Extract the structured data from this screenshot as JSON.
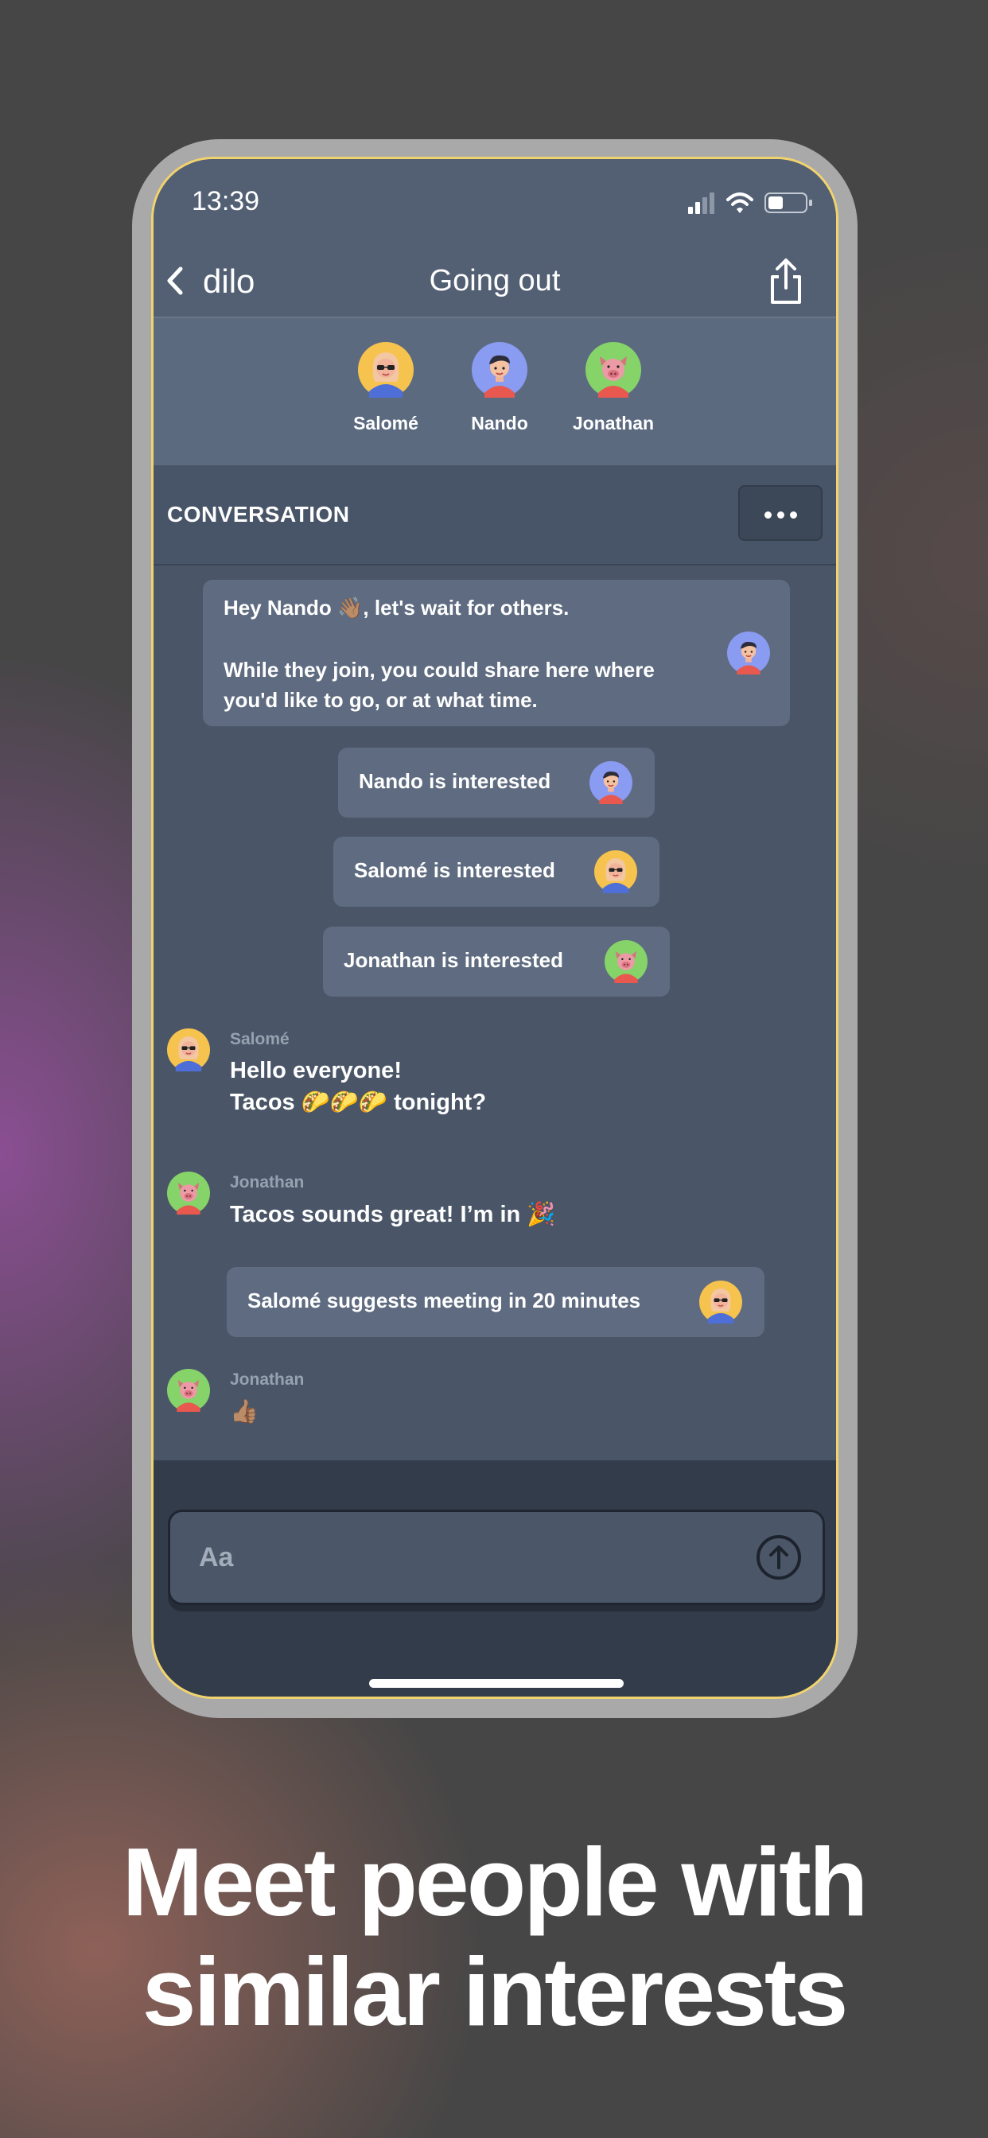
{
  "status_bar": {
    "time": "13:39"
  },
  "nav": {
    "app_name": "dilo",
    "title": "Going out"
  },
  "participants": [
    {
      "name": "Salomé",
      "avatar": "girl-sunglasses-avatar-icon",
      "color": "#f6c34f"
    },
    {
      "name": "Nando",
      "avatar": "boy-avatar-icon",
      "color": "#8a9bf2"
    },
    {
      "name": "Jonathan",
      "avatar": "pig-avatar-icon",
      "color": "#86d36a"
    }
  ],
  "conversation_header": {
    "title": "CONVERSATION"
  },
  "messages": {
    "welcome": {
      "line1": "Hey Nando 👋🏽, let's wait for others.",
      "line2": "While they join, you could share here where",
      "line3": "you'd like to go, or at what time."
    },
    "events": [
      {
        "text": "Nando is interested"
      },
      {
        "text": "Salomé is interested"
      },
      {
        "text": "Jonathan is interested"
      }
    ],
    "chat": [
      {
        "sender": "Salomé",
        "line1": "Hello everyone!",
        "line2": "Tacos 🌮🌮🌮 tonight?"
      },
      {
        "sender": "Jonathan",
        "line1": "Tacos sounds great! I’m in 🎉"
      },
      {
        "sender": "Jonathan",
        "line1": "👍🏽"
      }
    ],
    "suggestion": {
      "text": "Salomé suggests meeting in 20 minutes"
    }
  },
  "composer": {
    "placeholder": "Aa"
  },
  "headline": {
    "line1": "Meet people with",
    "line2": "similar interests"
  }
}
